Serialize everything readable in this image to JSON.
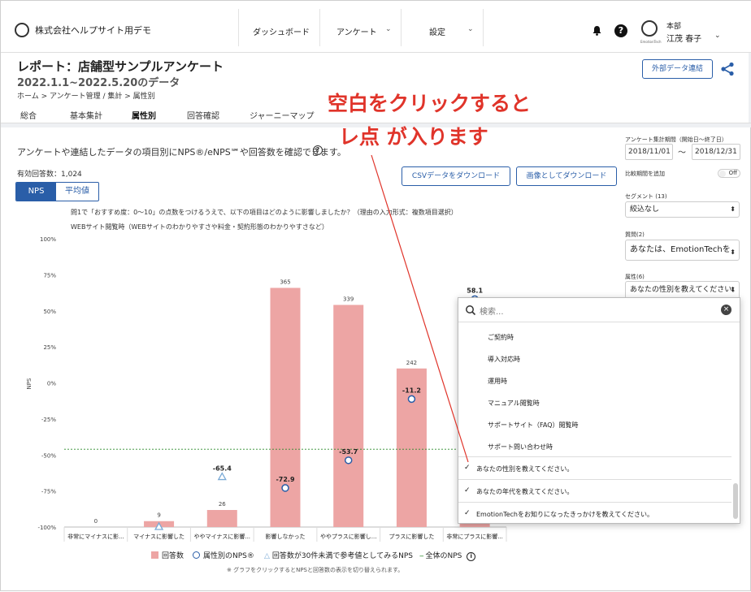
{
  "header": {
    "company": "株式会社ヘルプサイト用デモ",
    "nav": [
      {
        "label": "ダッシュボード"
      },
      {
        "label": "アンケート"
      },
      {
        "label": "設定"
      }
    ],
    "user_dept": "本部",
    "user_name": "江茂 春子",
    "avatar_caption": "EmotionTech"
  },
  "page": {
    "title": "レポート：店舗型サンプルアンケート",
    "subtitle": "2022.1.1~2022.5.20のデータ",
    "external_button": "外部データ連結",
    "breadcrumb": "ホーム > アンケート管理 / 集計 > 属性別",
    "tabs": [
      "総合",
      "基本集計",
      "属性別",
      "回答確認",
      "ジャーニーマップ"
    ],
    "active_tab": "属性別"
  },
  "callout": {
    "line1": "空白をクリックすると",
    "line2": "レ点 が入ります",
    "color": "#e0342a"
  },
  "main": {
    "description": "アンケートや連結したデータの項目別にNPS®/eNPS℠や回答数を確認できます。",
    "help": "?",
    "count": "有効回答数：1,024",
    "toggle": [
      "NPS",
      "平均値"
    ],
    "csv_button": "CSVデータをダウンロード",
    "img_button": "画像としてダウンロード",
    "question": "問1で「おすすめ度：0〜10」の点数をつけるうえで、以下の項目はどのように影響しましたか？（理由の入力形式：複数項目選択）",
    "attribute": "WEBサイト閲覧時（WEBサイトのわかりやすさや料金・契約形態のわかりやすさなど）",
    "legend": [
      "回答数",
      "属性別のNPS®",
      "回答数が30件未満で参考値としてみるNPS",
      "全体のNPS"
    ],
    "legend_info": "i",
    "note": "※ グラフをクリックするとNPSと回答数の表示を切り替えられます。"
  },
  "sidebar": {
    "period_label": "アンケート集計期間（開始日〜終了日）",
    "date_from": "2018/11/01",
    "date_sep": "〜",
    "date_to": "2018/12/31",
    "compare_label": "比較期間を追加",
    "compare_toggle": "Off",
    "segment_label": "セグメント (13)",
    "segment_value": "絞込なし",
    "question_label": "質問(2)",
    "question_value": "あなたは、EmotionTechを",
    "attr_label": "属性(6)",
    "attr_value": "あなたの性別を教えてください。"
  },
  "dropdown": {
    "placeholder": "検索...",
    "clear": "×",
    "items": [
      {
        "label": "ご契約時",
        "checked": false
      },
      {
        "label": "導入対応時",
        "checked": false
      },
      {
        "label": "運用時",
        "checked": false
      },
      {
        "label": "マニュアル閲覧時",
        "checked": false
      },
      {
        "label": "サポートサイト（FAQ）閲覧時",
        "checked": false
      },
      {
        "label": "サポート問い合わせ時",
        "checked": false
      },
      {
        "label": "あなたの性別を教えてください。",
        "checked": true
      },
      {
        "label": "あなたの年代を教えてください。",
        "checked": true
      },
      {
        "label": "EmotionTechをお知りになったきっかけを教えてください。",
        "checked": true
      }
    ]
  },
  "chart_data": {
    "type": "bar",
    "categories": [
      "非常にマイナスに影...",
      "マイナスに影響した",
      "ややマイナスに影響...",
      "影響しなかった",
      "ややプラスに影響し...",
      "プラスに影響した",
      "非常にプラスに影響..."
    ],
    "counts": [
      0,
      9,
      26,
      365,
      339,
      242,
      12
    ],
    "count_labels": [
      "0",
      "9",
      "26",
      "365",
      "339",
      "242",
      ""
    ],
    "nps": [
      null,
      -100,
      -65.4,
      -72.9,
      -53.7,
      -11.2,
      58.1
    ],
    "nps_labels": [
      "",
      "",
      "-65.4",
      "-72.9",
      "-53.7",
      "-11.2",
      "58.1"
    ],
    "nps_reference": [
      false,
      true,
      true,
      false,
      false,
      false,
      false
    ],
    "overall_nps": -46,
    "ylabel": "NPS",
    "yticks": [
      "100%",
      "75%",
      "50%",
      "25%",
      "0%",
      "-25%",
      "-50%",
      "-75%",
      "-100%"
    ],
    "ylim": [
      -100,
      100
    ],
    "count_max": 440,
    "bar_color": "#eda5a4",
    "nps_color": "#2a5ea8",
    "ref_color": "#7aaad6",
    "overall_color": "#2a8a2a"
  }
}
